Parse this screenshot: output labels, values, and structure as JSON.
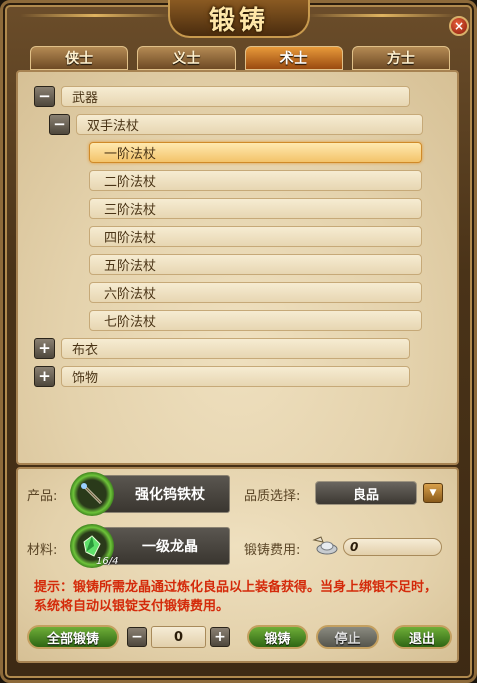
{
  "window": {
    "title": "锻铸",
    "close_glyph": "×"
  },
  "tabs": [
    {
      "label": "侠士",
      "active": false
    },
    {
      "label": "义士",
      "active": false
    },
    {
      "label": "术士",
      "active": true
    },
    {
      "label": "方士",
      "active": false
    }
  ],
  "tree": {
    "weapons": {
      "label": "武器",
      "toggle": "−"
    },
    "staff": {
      "label": "双手法杖",
      "toggle": "−"
    },
    "items": [
      "一阶法杖",
      "二阶法杖",
      "三阶法杖",
      "四阶法杖",
      "五阶法杖",
      "六阶法杖",
      "七阶法杖"
    ],
    "selected_index": 0,
    "cloth": {
      "label": "布衣",
      "toggle": "+"
    },
    "accessory": {
      "label": "饰物",
      "toggle": "+"
    }
  },
  "forge": {
    "product_label": "产品:",
    "product_name": "强化钨铁杖",
    "quality_label": "品质选择:",
    "quality_value": "良品",
    "quality_arrow": "▼",
    "material_label": "材料:",
    "material_name": "一级龙晶",
    "material_qty": "16/4",
    "cost_label": "锻铸费用:",
    "cost_value": "0"
  },
  "hint": "提示：锻铸所需龙晶通过炼化良品以上装备获得。当身上绑银不足时，系统将自动以银锭支付锻铸费用。",
  "controls": {
    "forge_all": "全部锻铸",
    "minus": "−",
    "plus": "+",
    "quantity": "0",
    "forge": "锻铸",
    "stop": "停止",
    "exit": "退出"
  },
  "colors": {
    "tab_active": "#e89a3a",
    "button_green": "#4e8a24",
    "hint_red": "#d42a0a",
    "selected_row": "#f3c36a"
  }
}
